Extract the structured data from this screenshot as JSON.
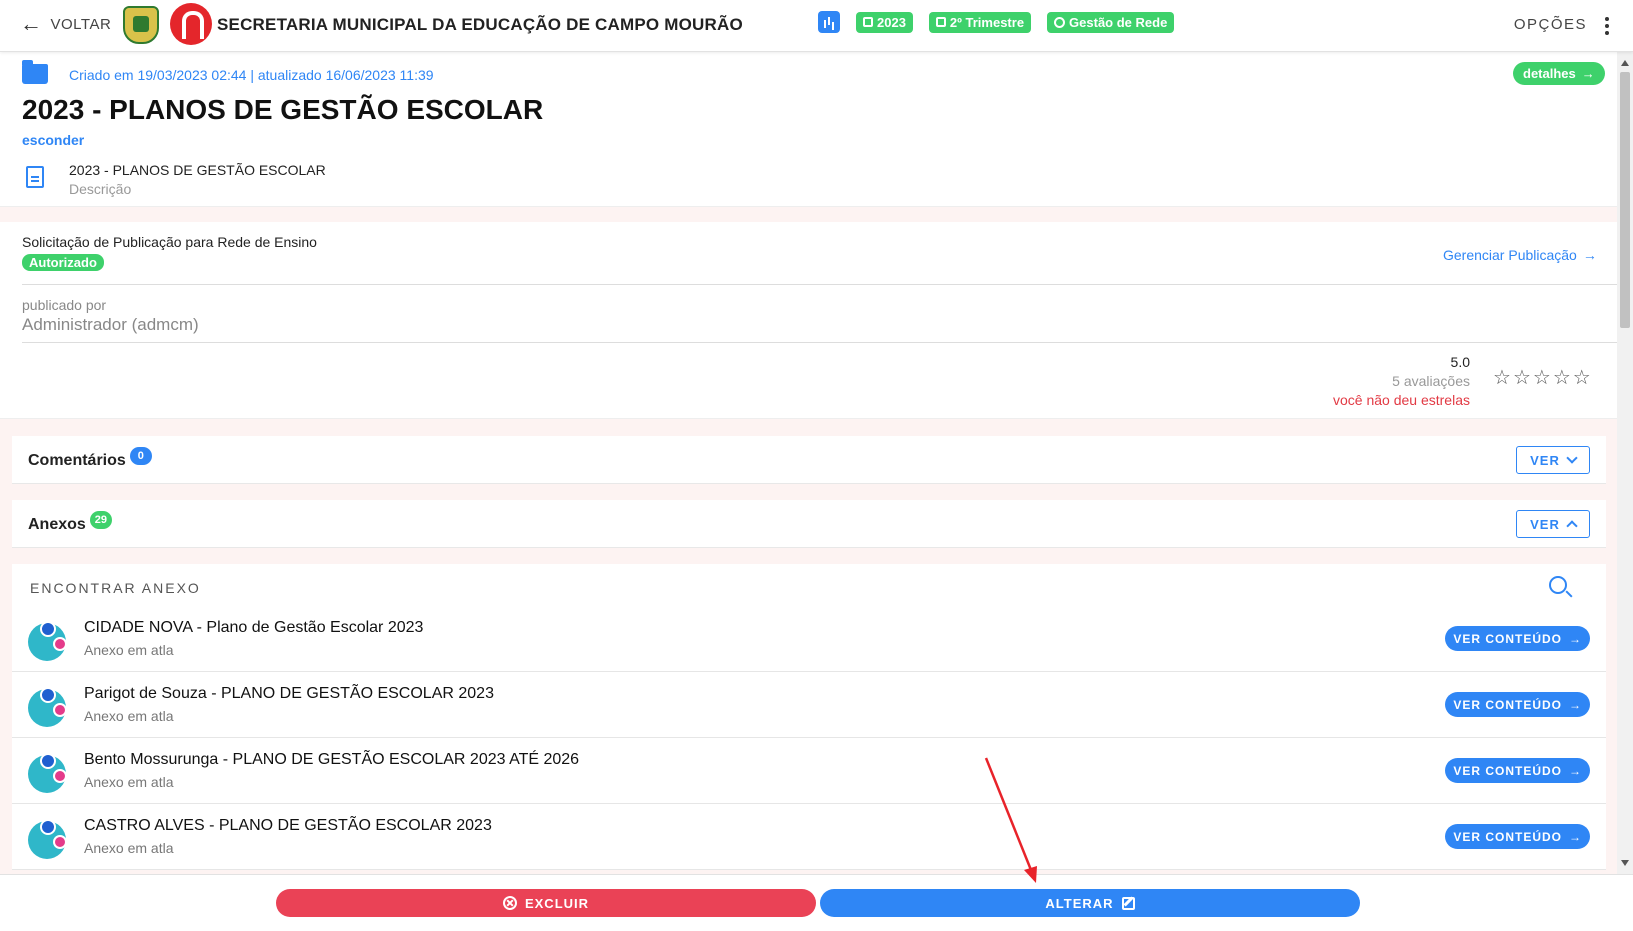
{
  "topbar": {
    "back_label": "VOLTAR",
    "org_title": "SECRETARIA MUNICIPAL DA EDUCAÇÃO DE CAMPO MOURÃO",
    "chips": [
      "2023",
      "2º Trimestre",
      "Gestão de Rede"
    ],
    "options_label": "OPÇÕES"
  },
  "header": {
    "meta": "Criado em 19/03/2023 02:44 | atualizado 16/06/2023 11:39",
    "details_label": "detalhes",
    "title": "2023 - PLANOS DE GESTÃO ESCOLAR",
    "hide_label": "esconder",
    "description_title": "2023 - PLANOS DE GESTÃO ESCOLAR",
    "description_label": "Descrição"
  },
  "publication": {
    "label": "Solicitação de Publicação para Rede de Ensino",
    "status": "Autorizado",
    "manage_label": "Gerenciar Publicação",
    "published_by_label": "publicado por",
    "published_by": "Administrador (admcm)"
  },
  "rating": {
    "value": "5.0",
    "count": "5 avaliações",
    "user_status": "você não deu estrelas",
    "stars": 5
  },
  "comments": {
    "label": "Comentários",
    "count": "0",
    "ver_label": "VER"
  },
  "attachments": {
    "label": "Anexos",
    "count": "29",
    "ver_label": "VER",
    "search_label": "ENCONTRAR ANEXO",
    "items": [
      {
        "title": "CIDADE NOVA - Plano de Gestão Escolar 2023",
        "subtitle": "Anexo em atla",
        "action": "VER CONTEÚDO"
      },
      {
        "title": "Parigot de Souza - PLANO DE GESTÃO ESCOLAR 2023",
        "subtitle": "Anexo em atla",
        "action": "VER CONTEÚDO"
      },
      {
        "title": "Bento Mossurunga - PLANO DE GESTÃO ESCOLAR 2023 ATÉ 2026",
        "subtitle": "Anexo em atla",
        "action": "VER CONTEÚDO"
      },
      {
        "title": "CASTRO ALVES - PLANO DE GESTÃO ESCOLAR 2023",
        "subtitle": "Anexo em atla",
        "action": "VER CONTEÚDO"
      }
    ]
  },
  "actions": {
    "delete_label": "EXCLUIR",
    "edit_label": "ALTERAR"
  },
  "colors": {
    "primary": "#2f86f5",
    "success": "#3ed16b",
    "danger": "#ea4256",
    "annotation": "#e8232a"
  }
}
